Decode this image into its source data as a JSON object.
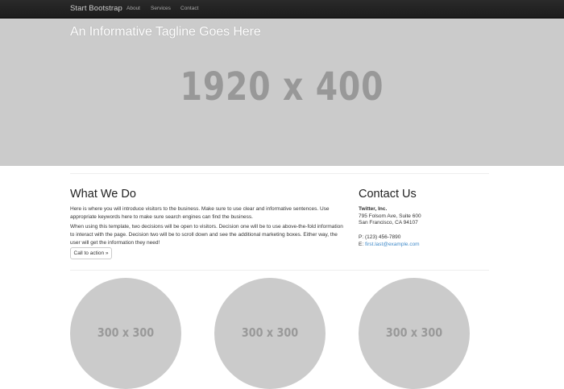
{
  "navbar": {
    "brand": "Start Bootstrap",
    "links": [
      "About",
      "Services",
      "Contact"
    ]
  },
  "hero": {
    "tagline": "An Informative Tagline Goes Here",
    "placeholder": "1920 x 400"
  },
  "what_we_do": {
    "title": "What We Do",
    "paragraph1": "Here is where you will introduce visitors to the business. Make sure to use clear and informative sentences. Use appropriate keywords here to make sure search engines can find the business.",
    "paragraph2": "When using this template, two decisions will be open to visitors. Decision one will be to use above-the-fold information to interact with the page. Decision two will be to scroll down and see the additional marketing boxes. Either way, the user will get the information they need!",
    "button": "Call to action »"
  },
  "contact": {
    "title": "Contact Us",
    "company": "Twitter, Inc.",
    "address1": "795 Folsom Ave, Suite 600",
    "address2": "San Francisco, CA 94107",
    "phone": "P: (123) 456-7890",
    "email_prefix": "E: ",
    "email": "first.last@example.com"
  },
  "features": [
    {
      "placeholder": "300 x 300"
    },
    {
      "placeholder": "300 x 300"
    },
    {
      "placeholder": "300 x 300"
    }
  ],
  "colors": {
    "navbar": "#222222",
    "placeholder": "#cbcbcb",
    "link": "#428bca"
  }
}
